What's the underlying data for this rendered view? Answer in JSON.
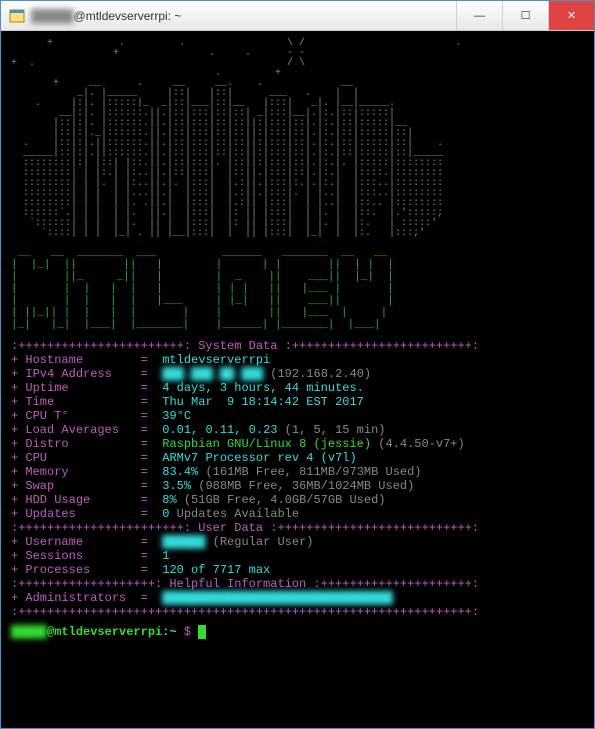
{
  "window": {
    "user_obscured": "█████",
    "title_suffix": "@mtldevserverrpi: ~"
  },
  "ascii_city": "      +           .         .                 \\ /                         .\n                 +               .     .      - -\n+  .                                          / \\\n                                  .         +\n       +     __      .     __     __.    .             __\n           _|. |_____     |::|   |::|      ___   .    |  |\n    .     |:|. |:::::|_  _|::|___|::|__   |:::|   _|. |__|_____.\n        __|:|. |::::::.||.|::|:::|::|::| _|:::|__|.|:.|::|:::::|\n       |::|:|. |::::::.||.|::|:::|::|::||:|:::|::|.|:.|::|:::::|__\n       |::|:|._|::::::.||.|::|:::|::|::||:|:::|::|.|:.|::|:::::|::|\n  .    |::|:|.||::::::.||.|::|:::|::|::||:|:::|::|.|:.|::|:::::|::|    .\n  _____|::|:|.||::::::.||.|::|:::|::|::||:|:::|::|.|:.|::|:::::|::|_____\n  ::::::::|:| |::| |::.||.|::|:::|. |::||:|:::|::|.|:.|. |:::::|::::::::\n  ::::::::| | |:.| |:..||.|::|:::|  |::||.|:::|::|.|:.|  |::::.|::::::::\n  ::::::::| | |. | |:..||.|. |:::|  |.:||.|:::|:.|.|:.|  |:::..|::::::::\n  ::::::::| | |  | |...||.|  |:::|  |.:||.|:::|. | |..|  |:::..|::::::::\n  ::::::::| | |  | |. .||.|  |:::|  |.:|| |:::|  | |..|  |::.. |::::::::\n  ::::::`.| | |  | |.  ||.|  |:::|  |: || |:::|  | |. |  |::.  |.':::::;\n   `::::::| | |  | |.  || |  |:::|  |: || |:::|  | |. |  |:.   | :::::'\n     `::::| | |  |_| . || |__|:::|  |  || |:::|  |_|  |  |:.   |:::;'",
  "mtl_dev": " __   __  _______  ___          ______   _______  __   __\n|  |_|  ||       ||   |        |      | |       ||  | |  |\n|       ||_     _||   |        |  _    ||    ___||  |_|  |\n|       |  |   |  |   |        | | |   ||   |___ |       |\n|       |  |   |  |   |___     | |_|   ||    ___||       |\n| ||_|| |  |   |  |       |    |       ||   |___  |     |\n|_|   |_|  |___|  |_______|    |______| |_______|  |___|",
  "sections": {
    "system": ":+++++++++++++++++++++++: System Data :+++++++++++++++++++++++++:",
    "user": ":+++++++++++++++++++++++: User Data :+++++++++++++++++++++++++++:",
    "help": ":+++++++++++++++++++: Helpful Information :+++++++++++++++++++++:",
    "footer": ":+++++++++++++++++++++++++++++++++++++++++++++++++++++++++++++++:"
  },
  "system_data": {
    "hostname_label": "Hostname",
    "hostname": "mtldevserverrpi",
    "ipv4_label": "IPv4 Address",
    "ipv4_obscured": "███.███.██.███",
    "ipv4_suffix": " (192.168.2.40)",
    "uptime_label": "Uptime",
    "uptime": "4 days, 3 hours, 44 minutes.",
    "time_label": "Time",
    "time": "Thu Mar  9 18:14:42 EST 2017",
    "cputemp_label": "CPU T°",
    "cputemp": "39°C",
    "load_label": "Load Averages",
    "load": "0.01, 0.11, 0.23",
    "load_suffix": " (1, 5, 15 min)",
    "distro_label": "Distro",
    "distro": "Raspbian GNU/Linux 8 (jessie)",
    "distro_suffix": " (4.4.50-v7+)",
    "cpu_label": "CPU",
    "cpu": "ARMv7 Processor rev 4 (v7l)",
    "mem_label": "Memory",
    "mem": "83.4%",
    "mem_suffix": " (161MB Free, 811MB/973MB Used)",
    "swap_label": "Swap",
    "swap": "3.5%",
    "swap_suffix": " (988MB Free, 36MB/1024MB Used)",
    "hdd_label": "HDD Usage",
    "hdd": "8%",
    "hdd_suffix": " (51GB Free, 4.0GB/57GB Used)",
    "updates_label": "Updates",
    "updates": "0",
    "updates_suffix": " Updates Available"
  },
  "user_data": {
    "username_label": "Username",
    "username_obscured": "██████",
    "username_suffix": " (Regular User)",
    "sessions_label": "Sessions",
    "sessions": "1",
    "processes_label": "Processes",
    "processes": "120 of 7717 max"
  },
  "help_data": {
    "admins_label": "Administrators",
    "admins_obscured": "████████████████████████████████"
  },
  "prompt": {
    "user_obscured": "█████",
    "host": "@mtldevserverrpi",
    "path": "~",
    "symbol": "$"
  }
}
